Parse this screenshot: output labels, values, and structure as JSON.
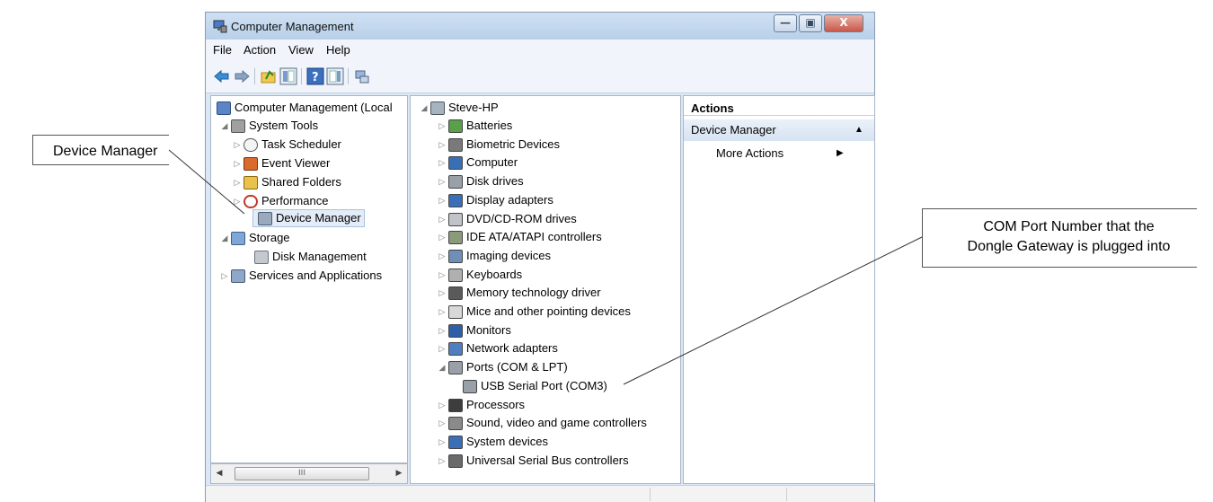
{
  "window": {
    "title": "Computer Management",
    "buttons": [
      "—",
      "▣",
      "X"
    ]
  },
  "menu": [
    "File",
    "Action",
    "View",
    "Help"
  ],
  "toolbar": {
    "icons": [
      "back-arrow-icon",
      "forward-arrow-icon",
      "up-folder-icon",
      "show-hide-tree-icon",
      "help-icon",
      "show-action-pane-icon",
      "connect-icon"
    ]
  },
  "left_tree": [
    {
      "label": "Computer Management (Local",
      "icon": "computer-management-icon"
    },
    {
      "label": "System Tools",
      "icon": "tools-icon"
    },
    {
      "label": "Task Scheduler",
      "icon": "clock-icon"
    },
    {
      "label": "Event Viewer",
      "icon": "event-viewer-icon"
    },
    {
      "label": "Shared Folders",
      "icon": "shared-folders-icon"
    },
    {
      "label": "Performance",
      "icon": "performance-icon"
    },
    {
      "label": "Device Manager",
      "icon": "device-manager-icon"
    },
    {
      "label": "Storage",
      "icon": "storage-icon"
    },
    {
      "label": "Disk Management",
      "icon": "disk-management-icon"
    },
    {
      "label": "Services and Applications",
      "icon": "services-icon"
    }
  ],
  "hscroll_label": "III",
  "device_tree": {
    "root": "Steve-HP",
    "items": [
      "Batteries",
      "Biometric Devices",
      "Computer",
      "Disk drives",
      "Display adapters",
      "DVD/CD-ROM drives",
      "IDE ATA/ATAPI controllers",
      "Imaging devices",
      "Keyboards",
      "Memory technology driver",
      "Mice and other pointing devices",
      "Monitors",
      "Network adapters",
      "Ports (COM & LPT)",
      "USB Serial Port (COM3)",
      "Processors",
      "Sound, video and game controllers",
      "System devices",
      "Universal Serial Bus controllers"
    ]
  },
  "actions": {
    "header": "Actions",
    "group": "Device Manager",
    "item": "More Actions"
  },
  "callouts": {
    "left": "Device Manager",
    "right_line1": "COM Port Number that the",
    "right_line2": "Dongle Gateway is plugged into"
  },
  "colors": {
    "title_bar": "#c3d7ee",
    "pane_bg": "#ffffff",
    "selection": "#e3ecf7"
  }
}
